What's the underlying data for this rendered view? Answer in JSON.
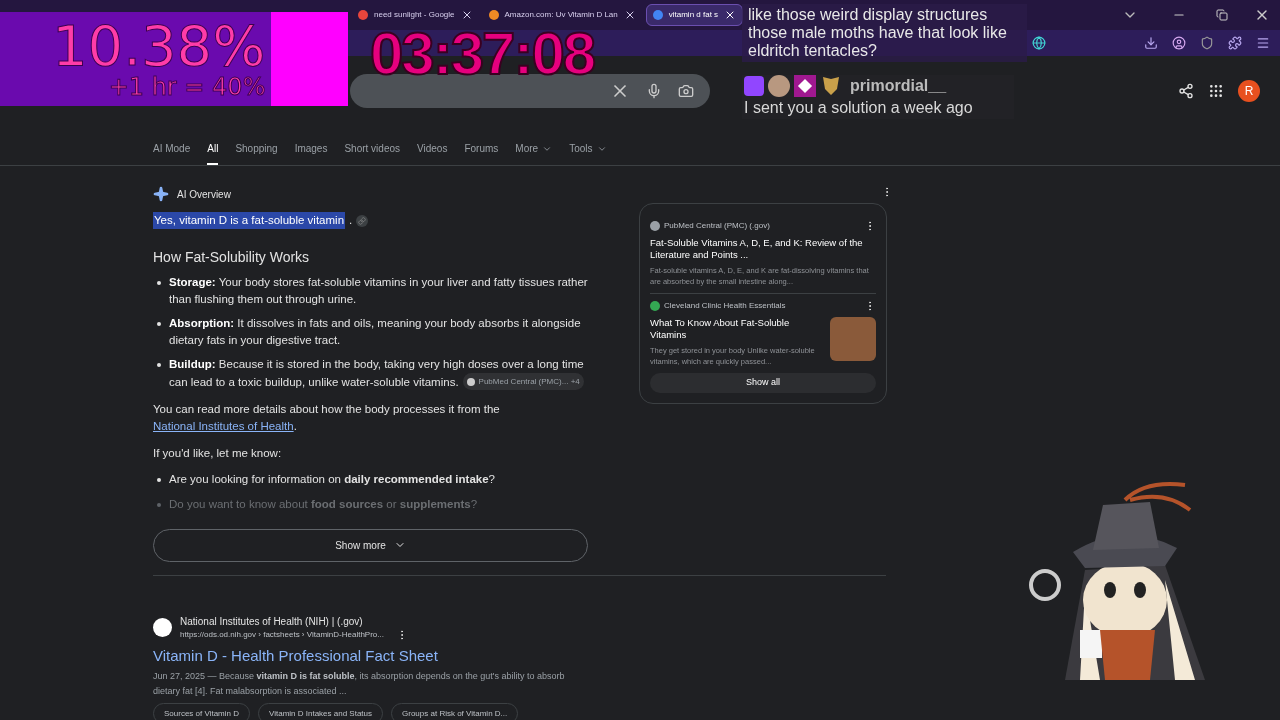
{
  "browser": {
    "tabs": [
      {
        "title": "need sunlight - Google",
        "selected": false,
        "color": "#e8453c"
      },
      {
        "title": "Amazon.com: Uv Vitamin D Lan",
        "selected": false,
        "color": "#f08a24"
      },
      {
        "title": "vitamin d fat s",
        "selected": true,
        "color": "#4285f4"
      }
    ]
  },
  "header": {
    "avatar": "R"
  },
  "nav_tabs": [
    {
      "label": "AI Mode",
      "selected": false,
      "has_menu": false
    },
    {
      "label": "All",
      "selected": true,
      "has_menu": false
    },
    {
      "label": "Shopping",
      "selected": false,
      "has_menu": false
    },
    {
      "label": "Images",
      "selected": false,
      "has_menu": false
    },
    {
      "label": "Short videos",
      "selected": false,
      "has_menu": false
    },
    {
      "label": "Videos",
      "selected": false,
      "has_menu": false
    },
    {
      "label": "Forums",
      "selected": false,
      "has_menu": false
    },
    {
      "label": "More",
      "selected": false,
      "has_menu": true
    },
    {
      "label": "Tools",
      "selected": false,
      "has_menu": true
    }
  ],
  "ai_overview": {
    "title": "AI Overview",
    "answer": "Yes, vitamin D is a fat-soluble vitamin",
    "answer_end": ".",
    "heading": "How Fat-Solubility Works",
    "bullets": [
      {
        "text": "**Storage:** Your body stores fat-soluble vitamins in your liver and fatty tissues rather than flushing them out through urine."
      },
      {
        "text": "**Absorption:** It dissolves in fats and oils, meaning your body absorbs it alongside dietary fats in your digestive tract."
      },
      {
        "text": "**Buildup:** Because it is stored in the body, taking very high doses over a long time can lead to a toxic buildup, unlike water-soluble vitamins.",
        "citation": "PubMed Central (PMC)...",
        "citation_count": "+4"
      }
    ],
    "more_text": "You can read more details about how the body processes it from the ",
    "more_link": "National Institutes of Health",
    "more_end": ".",
    "prompt": "If you'd like, let me know:",
    "questions": [
      {
        "text": "Are you looking for information on **daily recommended intake**?",
        "faded": false
      },
      {
        "text": "Do you want to know about **food sources** or **supplements**?",
        "faded": true
      }
    ],
    "show_more": "Show more"
  },
  "sources": {
    "items": [
      {
        "site": "PubMed Central (PMC) (.gov)",
        "color": "#9aa0a6",
        "title": "Fat-Soluble Vitamins A, D, E, and K: Review of the Literature and Points ...",
        "snippet": "Fat-soluble vitamins A, D, E, and K are fat-dissolving vitamins that are absorbed by the small intestine along...",
        "has_thumbnail": false
      },
      {
        "site": "Cleveland Clinic Health Essentials",
        "color": "#34a853",
        "title": "What To Know About Fat-Soluble Vitamins",
        "snippet": "They get stored in your body Unlike water-soluble vitamins, which are quickly passed...",
        "has_thumbnail": true
      }
    ],
    "show_all": "Show all"
  },
  "result": {
    "site": "National Institutes of Health (NIH) | (.gov)",
    "url": "https://ods.od.nih.gov › factsheets › VitaminD-HealthPro...",
    "title": "Vitamin D - Health Professional Fact Sheet",
    "snippet": "Jun 27, 2025 — Because **vitamin D is fat soluble**, its absorption depends on the gut's ability to absorb dietary fat [4]. Fat malabsorption is associated ...",
    "chips": [
      "Sources of Vitamin D",
      "Vitamin D Intakes and Status",
      "Groups at Risk of Vitamin D..."
    ]
  },
  "overlays": {
    "timer": {
      "percent": "10.38%",
      "bonus": "+1 hr = 40%",
      "time": "03:37:08",
      "level": 0.78
    },
    "chat": [
      {
        "text": "like those weird display structures those male moths have that look like eldritch tentacles?"
      },
      {
        "user": "primordial__",
        "text": "I sent you a solution a week ago"
      }
    ]
  }
}
